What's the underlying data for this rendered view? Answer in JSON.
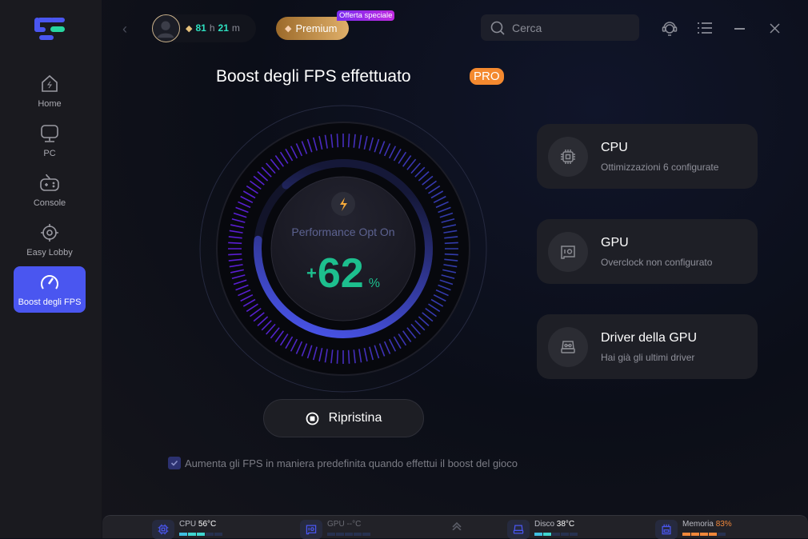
{
  "sidebar": {
    "items": [
      {
        "label": "Home",
        "icon": "home-icon"
      },
      {
        "label": "PC",
        "icon": "monitor-icon"
      },
      {
        "label": "Console",
        "icon": "gamepad-icon"
      },
      {
        "label": "Easy Lobby",
        "icon": "crosshair-icon"
      },
      {
        "label": "Boost degli FPS",
        "icon": "speedometer-icon",
        "active": true
      }
    ]
  },
  "header": {
    "time_hours": "81",
    "time_h_unit": "h",
    "time_minutes": "21",
    "time_m_unit": "m",
    "premium_label": "Premium",
    "special_offer": "Offerta speciale",
    "search_placeholder": "Cerca"
  },
  "main": {
    "title": "Boost degli FPS effettuato",
    "pro_badge": "PRO",
    "gauge": {
      "status": "Performance Opt On",
      "sign": "+",
      "value": "62",
      "unit": "%"
    },
    "reset_label": "Ripristina",
    "checkbox_label": "Aumenta gli FPS in maniera predefinita quando effettui il boost del gioco",
    "checkbox_checked": true
  },
  "cards": [
    {
      "title": "CPU",
      "subtitle": "Ottimizzazioni 6 configurate",
      "icon": "cpu-icon"
    },
    {
      "title": "GPU",
      "subtitle": "Overclock non configurato",
      "icon": "gpu-icon"
    },
    {
      "title": "Driver della GPU",
      "subtitle": "Hai già gli ultimi driver",
      "icon": "driver-icon"
    }
  ],
  "statusbar": [
    {
      "label": "CPU",
      "value": "56°C",
      "level": 3,
      "color": "#3fd6d0"
    },
    {
      "label": "GPU",
      "value": "--°C",
      "level": 0,
      "color": "#3fd6d0"
    },
    {
      "label": "Disco",
      "value": "38°C",
      "level": 2,
      "color": "#3fd6d0"
    },
    {
      "label": "Memoria",
      "value": "83%",
      "level": 4,
      "color": "#f0873a"
    }
  ],
  "colors": {
    "accent": "#4a56f0",
    "green": "#1dbf8e",
    "pro": "#f4892f"
  }
}
